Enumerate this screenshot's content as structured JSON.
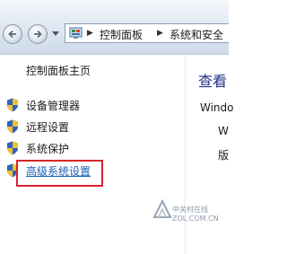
{
  "address_bar": {
    "breadcrumbs": [
      "控制面板",
      "系统和安全"
    ],
    "separator": "▶"
  },
  "left_pane": {
    "home_link": "控制面板主页",
    "tasks": [
      {
        "label": "设备管理器",
        "icon": "uac-shield-icon"
      },
      {
        "label": "远程设置",
        "icon": "uac-shield-icon"
      },
      {
        "label": "系统保护",
        "icon": "uac-shield-icon"
      },
      {
        "label": "高级系统设置",
        "icon": "uac-shield-icon",
        "highlighted": true
      }
    ]
  },
  "main": {
    "heading": "查看",
    "lines": [
      "Windo",
      "W",
      "版"
    ]
  },
  "watermark": {
    "top": "中关村在线",
    "bottom": "ZOL.COM.CN"
  },
  "colors": {
    "highlight_border": "#d7232a",
    "link": "#1a5fb4",
    "heading": "#1e3287"
  }
}
